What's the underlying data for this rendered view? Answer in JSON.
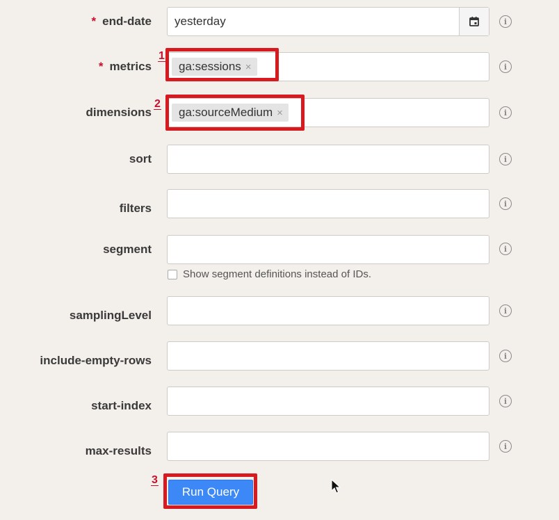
{
  "fields": [
    {
      "id": "end-date",
      "label": "end-date",
      "required": true,
      "value": "yesterday"
    },
    {
      "id": "metrics",
      "label": "metrics",
      "required": true,
      "chip": "ga:sessions"
    },
    {
      "id": "dimensions",
      "label": "dimensions",
      "required": false,
      "chip": "ga:sourceMedium"
    },
    {
      "id": "sort",
      "label": "sort",
      "required": false,
      "value": ""
    },
    {
      "id": "filters",
      "label": "filters",
      "required": false,
      "value": ""
    },
    {
      "id": "segment",
      "label": "segment",
      "required": false,
      "value": ""
    },
    {
      "id": "samplingLevel",
      "label": "samplingLevel",
      "required": false,
      "value": ""
    },
    {
      "id": "include-empty-rows",
      "label": "include-empty-rows",
      "required": false,
      "value": ""
    },
    {
      "id": "start-index",
      "label": "start-index",
      "required": false,
      "value": ""
    },
    {
      "id": "max-results",
      "label": "max-results",
      "required": false,
      "value": ""
    }
  ],
  "required_marker": "*",
  "chip_remove": "×",
  "info_glyph": "i",
  "segment_checkbox_label": "Show segment definitions instead of IDs.",
  "run_button_label": "Run Query",
  "annotations": [
    "1",
    "2",
    "3"
  ],
  "colors": {
    "highlight": "#d71920",
    "button": "#3d88f7",
    "background": "#f3efeb"
  }
}
